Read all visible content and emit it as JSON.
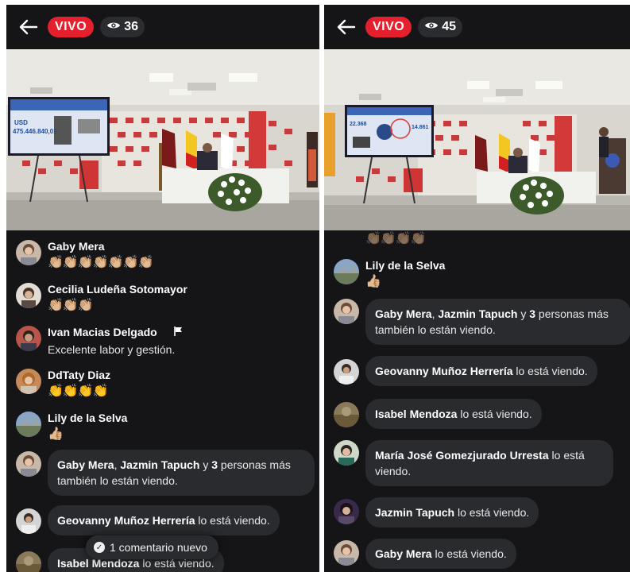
{
  "left": {
    "live_label": "VIVO",
    "viewer_count": "36",
    "comments": [
      {
        "name": "Gaby Mera",
        "emojis": "👏🏼👏🏼👏🏼👏🏼👏🏼👏🏼👏🏼"
      },
      {
        "name": "Cecilia Ludeña Sotomayor",
        "emojis": "👏🏼👏🏼👏🏼"
      },
      {
        "name": "Ivan Macias Delgado",
        "text": "Excelente labor y gestión."
      },
      {
        "name": "DdTaty Diaz",
        "emojis": "👏👏👏👏"
      },
      {
        "name": "Lily de la Selva",
        "emojis": "👍🏼"
      }
    ],
    "viewing": [
      {
        "names_a": "Gaby Mera",
        "sep": ", ",
        "names_b": "Jazmin Tapuch",
        "mid": " y ",
        "count": "3",
        "rest": " personas más también lo están viendo."
      },
      {
        "name": "Geovanny Muñoz Herrería",
        "rest": " lo está viendo."
      },
      {
        "name": "Isabel Mendoza",
        "rest": " lo está viendo."
      }
    ],
    "toast": "1 comentario nuevo"
  },
  "right": {
    "live_label": "VIVO",
    "viewer_count": "45",
    "partial_emojis": "👏🏼👏🏼👏🏼👏🏼",
    "comments": [
      {
        "name": "Lily de la Selva",
        "emojis": "👍🏼"
      }
    ],
    "viewing": [
      {
        "names_a": "Gaby Mera",
        "sep": ", ",
        "names_b": "Jazmin Tapuch",
        "mid": " y ",
        "count": "3",
        "rest": " personas más también lo están viendo."
      },
      {
        "name": "Geovanny Muñoz Herrería",
        "rest": " lo está viendo."
      },
      {
        "name": "Isabel Mendoza",
        "rest": " lo está viendo."
      },
      {
        "name": "María José Gomezjurado Urresta",
        "rest": " lo está viendo."
      },
      {
        "name": "Jazmin Tapuch",
        "rest": " lo está viendo."
      },
      {
        "name": "Gaby Mera",
        "rest": " lo está viendo."
      }
    ]
  },
  "video": {
    "slide_left_label": "USD",
    "slide_left_amount": "475.446.840,01",
    "slide_right_amount_a": "22.368",
    "slide_right_amount_b": "14.861"
  },
  "colors": {
    "live": "#e4202f",
    "panel_bg": "#151518",
    "bubble_bg": "#2a2b2f"
  },
  "icons": [
    "back-arrow-icon",
    "eye-icon",
    "flag-icon",
    "check-circle-icon"
  ]
}
